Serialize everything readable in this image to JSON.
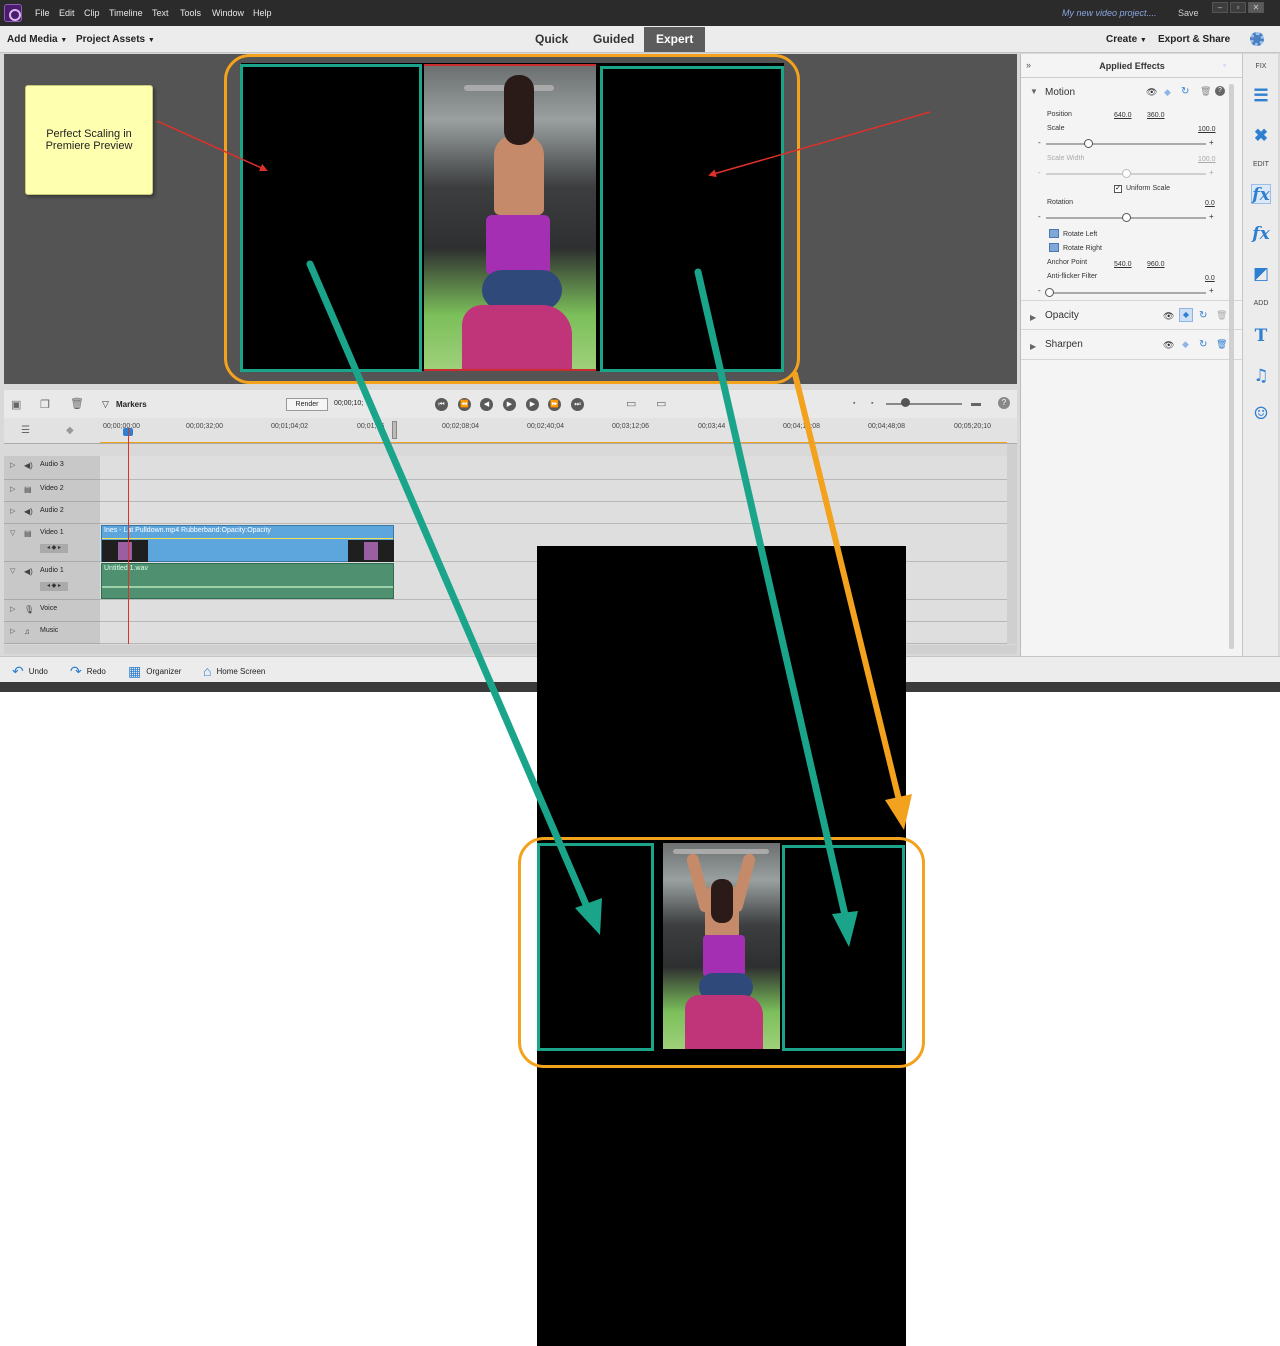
{
  "menubar": {
    "items": [
      "File",
      "Edit",
      "Clip",
      "Timeline",
      "Text",
      "Tools",
      "Window",
      "Help"
    ],
    "project_title": "My new video project....",
    "save_label": "Save"
  },
  "toolbar": {
    "add_media": "Add Media",
    "project_assets": "Project Assets",
    "tabs": [
      "Quick",
      "Guided",
      "Expert"
    ],
    "active_tab": "Expert",
    "create": "Create",
    "export_share": "Export & Share"
  },
  "monitor": {
    "note_text": "Perfect Scaling in\nPremiere Preview"
  },
  "applied_effects": {
    "title": "Applied Effects",
    "motion": {
      "name": "Motion",
      "position_label": "Position",
      "position_x": "640.0",
      "position_y": "360.0",
      "scale_label": "Scale",
      "scale_value": "100.0",
      "scale_width_label": "Scale Width",
      "scale_width_value": "100.0",
      "uniform_scale_label": "Uniform Scale",
      "rotation_label": "Rotation",
      "rotation_value": "0.0",
      "rotate_left": "Rotate Left",
      "rotate_right": "Rotate Right",
      "anchor_label": "Anchor Point",
      "anchor_x": "540.0",
      "anchor_y": "960.0",
      "antiflicker_label": "Anti-flicker Filter",
      "antiflicker_value": "0.0"
    },
    "opacity": "Opacity",
    "sharpen": "Sharpen"
  },
  "sidebar": {
    "fix": "FIX",
    "edit": "EDIT",
    "add": "ADD"
  },
  "timeline": {
    "markers": "Markers",
    "render": "Render",
    "timecode": "00;00;10;",
    "ruler": [
      "00;00;00;00",
      "00;00;32;00",
      "00;01;04;02",
      "00;01;36",
      "00;02;08;04",
      "00;02;40;04",
      "00;03;12;06",
      "00;03;44",
      "00;04;16;08",
      "00;04;48;08",
      "00;05;20;10"
    ],
    "tracks": [
      "Audio 3",
      "Video 2",
      "Audio 2",
      "Video 1",
      "Audio 1",
      "Voice",
      "Music"
    ],
    "video_clip": "Ines - Lat Pulldown.mp4 Rubberband:Opacity:Opacity",
    "audio_clip": "Untitled 1.wav"
  },
  "bottombar": {
    "undo": "Undo",
    "redo": "Redo",
    "organizer": "Organizer",
    "home": "Home Screen"
  },
  "colors": {
    "teal": "#1aa58a",
    "orange": "#f2a21d",
    "red_arrow": "#e0302a",
    "accent_blue": "#2f7fd1"
  }
}
